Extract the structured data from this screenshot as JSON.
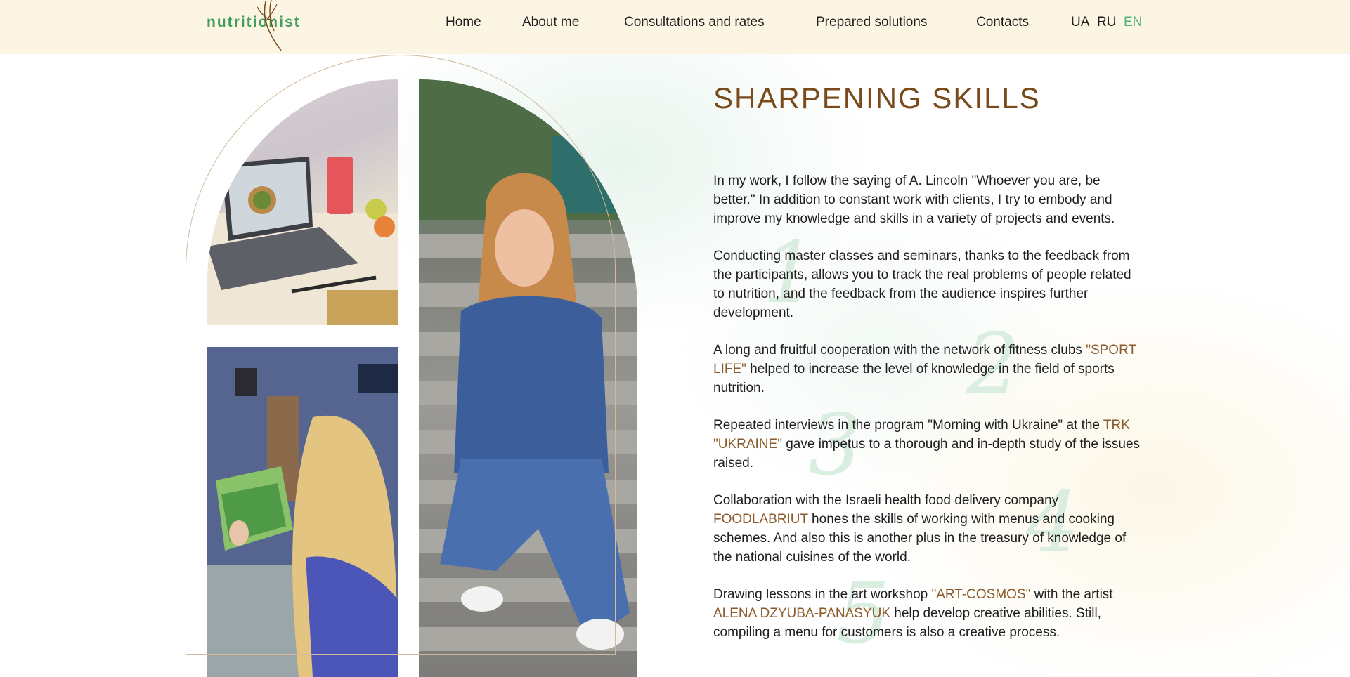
{
  "header": {
    "logo_text": "nutritionist",
    "nav": [
      {
        "label": "Home"
      },
      {
        "label": "About me"
      },
      {
        "label": "Consultations and rates"
      },
      {
        "label": "Prepared solutions"
      },
      {
        "label": "Contacts"
      }
    ],
    "languages": [
      {
        "label": "UA",
        "active": false
      },
      {
        "label": "RU",
        "active": false
      },
      {
        "label": "EN",
        "active": true
      }
    ]
  },
  "section": {
    "title": "SHARPENING SKILLS",
    "paragraphs": [
      {
        "parts": [
          {
            "text": "In my work, I follow the saying of A. Lincoln \"Whoever you are, be better.\" In addition to constant work with clients, I try to embody and improve my knowledge and skills in a variety of projects and events."
          }
        ]
      },
      {
        "parts": [
          {
            "text": "Conducting master classes and seminars, thanks to the feedback from the participants, allows you to track the real problems of people related to nutrition, and the feedback from the audience inspires further development."
          }
        ]
      },
      {
        "parts": [
          {
            "text": "A long and fruitful cooperation with the network of fitness clubs "
          },
          {
            "text": "\"SPORT LIFE\"",
            "highlight": true
          },
          {
            "text": " helped to increase the level of knowledge in the field of sports nutrition."
          }
        ]
      },
      {
        "parts": [
          {
            "text": "Repeated interviews in the program \"Morning with Ukraine\" at the "
          },
          {
            "text": "TRK \"UKRAINE\"",
            "highlight": true
          },
          {
            "text": " gave impetus to a thorough and in-depth study of the issues raised."
          }
        ]
      },
      {
        "parts": [
          {
            "text": "Collaboration with the Israeli health food delivery company "
          },
          {
            "text": "FOODLABRIUT",
            "highlight": true
          },
          {
            "text": " hones the skills of working with menus and cooking schemes. And also this is another plus in the treasury of knowledge of the national cuisines of the world."
          }
        ]
      },
      {
        "parts": [
          {
            "text": "Drawing lessons in the art workshop "
          },
          {
            "text": "\"ART-COSMOS\"",
            "highlight": true
          },
          {
            "text": " with the artist "
          },
          {
            "text": "ALENA DZYUBA-PANASYUK",
            "highlight": true
          },
          {
            "text": " help develop creative abilities. Still, compiling a menu for customers is also a creative process."
          }
        ]
      }
    ],
    "decor_numbers": [
      "1",
      "2",
      "3",
      "4",
      "5"
    ]
  },
  "photos": [
    {
      "name": "laptop-photo"
    },
    {
      "name": "painting-photo"
    },
    {
      "name": "portrait-photo"
    }
  ],
  "colors": {
    "header_bg": "#fcf5e4",
    "accent_green": "#4fb27a",
    "title_brown": "#7a4a1a",
    "highlight_brown": "#8a5a2a",
    "arch_line": "#d4b99a"
  }
}
